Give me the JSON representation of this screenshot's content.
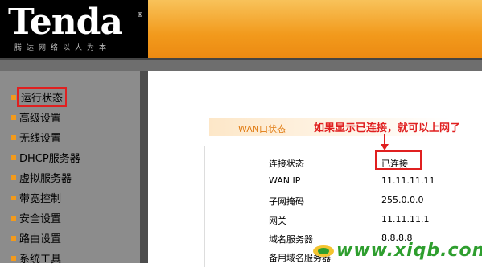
{
  "header": {
    "brand": "Tenda",
    "brand_mark": "®",
    "slogan": "腾达网络以人为本"
  },
  "sidebar": {
    "items": [
      {
        "label": "运行状态"
      },
      {
        "label": "高级设置"
      },
      {
        "label": "无线设置"
      },
      {
        "label": "DHCP服务器"
      },
      {
        "label": "虚拟服务器"
      },
      {
        "label": "带宽控制"
      },
      {
        "label": "安全设置"
      },
      {
        "label": "路由设置"
      },
      {
        "label": "系统工具"
      }
    ]
  },
  "main": {
    "section_title": "WAN口状态",
    "annotation": "如果显示已连接，就可以上网了",
    "rows": [
      {
        "label": "连接状态",
        "value": "已连接"
      },
      {
        "label": "WAN IP",
        "value": "11.11.11.11"
      },
      {
        "label": "子网掩码",
        "value": "255.0.0.0"
      },
      {
        "label": "网关",
        "value": "11.11.11.1"
      },
      {
        "label": "域名服务器",
        "value": "8.8.8.8"
      },
      {
        "label": "备用域名服务器",
        "value": ""
      }
    ]
  },
  "watermark": {
    "text": "www.xiqb.com"
  },
  "colors": {
    "accent_orange": "#f29a1c",
    "highlight_red": "#e02020",
    "sidebar_gray": "#8c8c8c",
    "watermark_green": "#2e9e2e"
  }
}
